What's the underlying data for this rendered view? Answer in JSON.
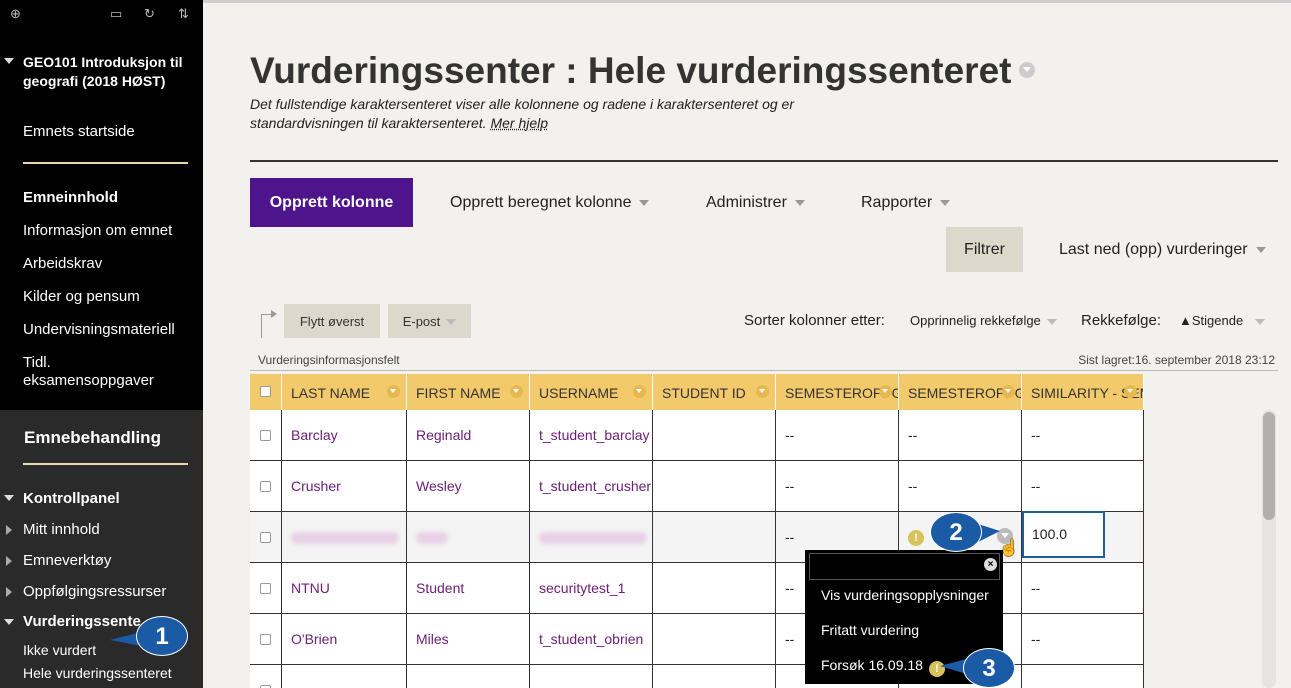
{
  "sidebar": {
    "course_title": "GEO101 Introduksjon til geografi (2018 HØST)",
    "start_page": "Emnets startside",
    "content_heading": "Emneinnhold",
    "content_items": [
      "Informasjon om emnet",
      "Arbeidskrav",
      "Kilder og pensum",
      "Undervisningsmateriell",
      "Tidl. eksamensoppgaver"
    ],
    "management_heading": "Emnebehandling",
    "control_panel": "Kontrollpanel",
    "panel_items": [
      "Mitt innhold",
      "Emneverktøy",
      "Oppfølgingsressurser"
    ],
    "grade_center": "Vurderingssenter",
    "grade_sub_items": [
      "Ikke vurdert",
      "Hele vurderingssenteret"
    ]
  },
  "page": {
    "title": "Vurderingssenter : Hele vurderingssenteret",
    "description": "Det fullstendige karaktersenteret viser alle kolonnene og radene i karaktersenteret og er standardvisningen til karaktersenteret.",
    "help_link": "Mer hjelp"
  },
  "toolbar": {
    "create_column": "Opprett kolonne",
    "create_calculated": "Opprett beregnet kolonne",
    "manage": "Administrer",
    "reports": "Rapporter",
    "filter": "Filtrer",
    "download": "Last ned (opp) vurderinger"
  },
  "actions": {
    "move_top": "Flytt øverst",
    "email": "E-post",
    "sort_columns_label": "Sorter kolonner etter:",
    "sort_columns_value": "Opprinnelig rekkefølge",
    "order_label": "Rekkefølge:",
    "order_value": "▲Stigende"
  },
  "info": {
    "left": "Vurderingsinformasjonsfelt",
    "right": "Sist lagret:16. september 2018 23:12"
  },
  "grid": {
    "headers": [
      "LAST NAME",
      "FIRST NAME",
      "USERNAME",
      "STUDENT ID",
      "SEMESTEROPPGAVE",
      "SEMESTEROPPGAVE",
      "SIMILARITY - SEMESTEROPPGAVE"
    ],
    "rows": [
      {
        "last": "Barclay",
        "first": "Reginald",
        "username": "t_student_barclay",
        "student_id": "",
        "c1": "--",
        "c2": "--",
        "c3": "--"
      },
      {
        "last": "Crusher",
        "first": "Wesley",
        "username": "t_student_crusher",
        "student_id": "",
        "c1": "--",
        "c2": "--",
        "c3": "--"
      },
      {
        "last": "",
        "first": "",
        "username": "",
        "student_id": "",
        "c1": "--",
        "c2": "",
        "c3": "100.0"
      },
      {
        "last": "NTNU",
        "first": "Student",
        "username": "securitytest_1",
        "student_id": "",
        "c1": "--",
        "c2": "",
        "c3": "--"
      },
      {
        "last": "O'Brien",
        "first": "Miles",
        "username": "t_student_obrien",
        "student_id": "",
        "c1": "--",
        "c2": "",
        "c3": "--"
      }
    ]
  },
  "context_menu": {
    "items": [
      "Vis vurderingsopplysninger",
      "Fritatt vurdering",
      "Forsøk 16.09.18"
    ]
  },
  "callouts": [
    "1",
    "2",
    "3"
  ],
  "colors": {
    "accent": "#4d148c",
    "header": "#f2c96b",
    "link": "#6d2077",
    "callout": "#1b5aa5"
  }
}
